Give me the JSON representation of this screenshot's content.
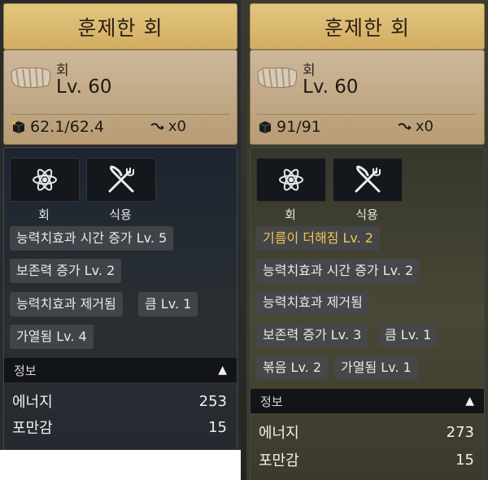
{
  "left": {
    "title": "훈제한 회",
    "item_type": "회",
    "item_level": "Lv. 60",
    "weight": "62.1/62.4",
    "arrow_count": "x0",
    "icon_labels": [
      "회",
      "식용"
    ],
    "effects": [
      "능력치효과 시간 증가  Lv. 5",
      "보존력 증가 Lv. 2",
      "능력치효과 제거됨",
      "큼 Lv. 1",
      "가열됨 Lv. 4"
    ],
    "info_title": "정보",
    "info_toggle": "▲",
    "rows": [
      {
        "label": "에너지",
        "value": "253"
      },
      {
        "label": "포만감",
        "value": "15"
      }
    ]
  },
  "right": {
    "title": "훈제한 회",
    "item_type": "회",
    "item_level": "Lv. 60",
    "weight": "91/91",
    "arrow_count": "x0",
    "icon_labels": [
      "회",
      "식용"
    ],
    "effects": [
      "기름이 더해짐 Lv. 2",
      "능력치효과 시간 증가  Lv. 2",
      "능력치효과 제거됨",
      "보존력 증가 Lv. 3",
      "큼 Lv. 1",
      "볶음 Lv. 2",
      "가열됨 Lv. 1"
    ],
    "info_title": "정보",
    "info_toggle": "▲",
    "rows": [
      {
        "label": "에너지",
        "value": "273"
      },
      {
        "label": "포만감",
        "value": "15"
      }
    ]
  },
  "colors": {
    "title_gold": "#d8b66c",
    "highlight_effect": "#f0c64a"
  },
  "icons": [
    "atom-icon",
    "fork-knife-icon",
    "box-icon",
    "arrow-icon",
    "triangle-up-icon"
  ]
}
